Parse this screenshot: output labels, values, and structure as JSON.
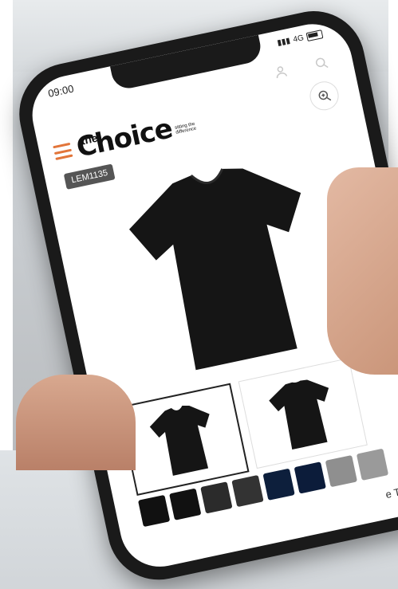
{
  "status": {
    "time": "09:00",
    "network": "4G"
  },
  "brand": {
    "the": "the",
    "choice": "Choice",
    "tagline": "sitting the difference"
  },
  "product": {
    "code": "LEM1135",
    "name_partial": "e T-shirt"
  },
  "icons": {
    "user": "user-icon",
    "search": "search-icon",
    "zoom": "zoom-in-icon",
    "menu": "menu-icon"
  },
  "swatch_colors": [
    "#111111",
    "#111111",
    "#2b2b2b",
    "#333333",
    "#0d1f3c",
    "#0c1c3a",
    "#8f8f8f",
    "#9a9a9a"
  ],
  "colors": {
    "accent": "#e2753a"
  }
}
